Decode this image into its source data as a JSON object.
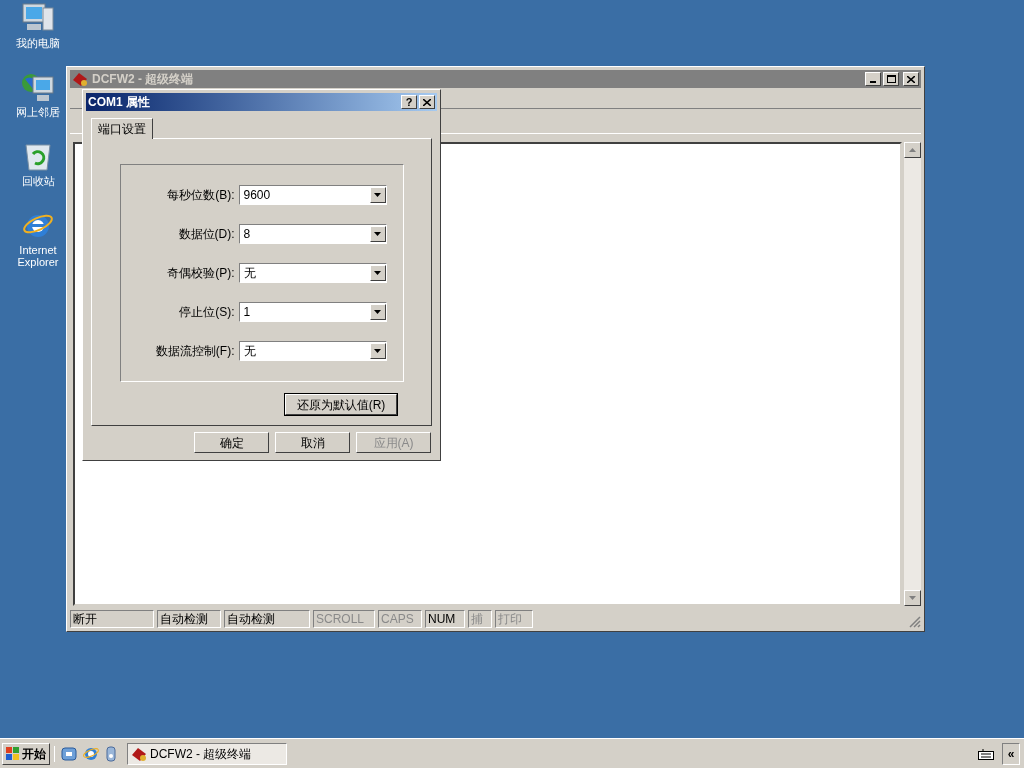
{
  "desktop_icons": [
    {
      "label": "我的电脑",
      "kind": "computer"
    },
    {
      "label": "网上邻居",
      "kind": "network"
    },
    {
      "label": "回收站",
      "kind": "recycle"
    },
    {
      "label": "Internet Explorer",
      "kind": "browser"
    }
  ],
  "main_window": {
    "title": "DCFW2 - 超级终端",
    "active": false,
    "status_bar": [
      {
        "text": "断开",
        "enabled": true
      },
      {
        "text": "自动检测",
        "enabled": true
      },
      {
        "text": "自动检测",
        "enabled": true
      },
      {
        "text": "SCROLL",
        "enabled": false
      },
      {
        "text": "CAPS",
        "enabled": false
      },
      {
        "text": "NUM",
        "enabled": true
      },
      {
        "text": "捕",
        "enabled": false
      },
      {
        "text": "打印",
        "enabled": false
      }
    ]
  },
  "dialog": {
    "title": "COM1 属性",
    "help": "?",
    "active": true,
    "tabs": [
      {
        "label": "端口设置",
        "selected": true
      }
    ],
    "fields": [
      {
        "label": "每秒位数(B):",
        "value": "9600"
      },
      {
        "label": "数据位(D):",
        "value": "8"
      },
      {
        "label": "奇偶校验(P):",
        "value": "无"
      },
      {
        "label": "停止位(S):",
        "value": "1"
      },
      {
        "label": "数据流控制(F):",
        "value": "无"
      }
    ],
    "restore_button": {
      "label": "还原为默认值(R)",
      "focused": true
    },
    "buttons": [
      {
        "label": "确定",
        "disabled": false
      },
      {
        "label": "取消",
        "disabled": false
      },
      {
        "label": "应用(A)",
        "disabled": true
      }
    ]
  },
  "taskbar": {
    "start": "开始",
    "quick_launch": [
      {
        "kind": "desktop"
      },
      {
        "kind": "browser"
      },
      {
        "kind": "media"
      }
    ],
    "tasks": [
      {
        "label": "DCFW2 - 超级终端",
        "selected": true
      }
    ],
    "expand": "«"
  }
}
